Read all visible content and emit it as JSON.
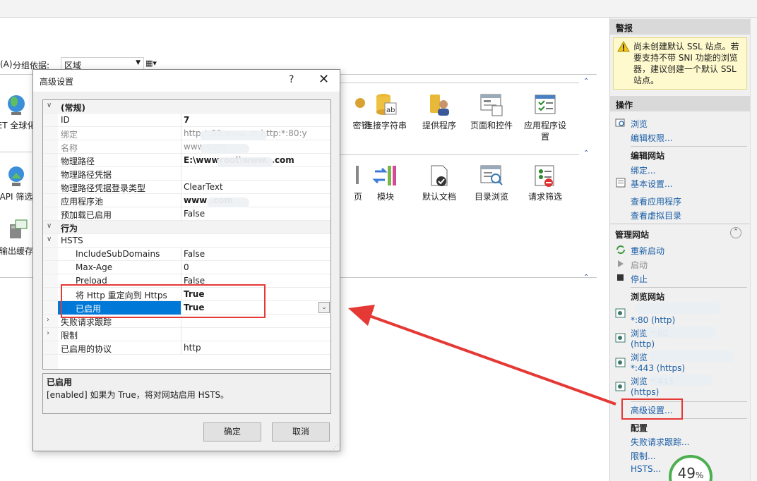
{
  "center": {
    "groupbar": {
      "mode_fragment": "(A)",
      "group_by_label": "分组依据:",
      "group_by_value": "区域"
    },
    "features_row1": [
      {
        "label": "ET 全球化",
        "icon": "globe-icon"
      },
      {
        "label": "密钥",
        "icon": "key-icon"
      },
      {
        "label": "连接字符串",
        "icon": "database-ab-icon"
      },
      {
        "label": "提供程序",
        "icon": "provider-icon"
      },
      {
        "label": "页面和控件",
        "icon": "pages-controls-icon"
      },
      {
        "label": "应用程序设\n置",
        "icon": "app-settings-icon"
      }
    ],
    "features_row2": [
      {
        "label": "API 筛选",
        "icon": "isapi-filter-icon"
      },
      {
        "label": "页",
        "icon": "pages-icon"
      },
      {
        "label": "模块",
        "icon": "modules-icon"
      },
      {
        "label": "默认文档",
        "icon": "default-document-icon"
      },
      {
        "label": "目录浏览",
        "icon": "directory-browsing-icon"
      },
      {
        "label": "请求筛选",
        "icon": "request-filtering-icon"
      }
    ],
    "features_row3": [
      {
        "label": "输出缓存",
        "icon": "output-cache-icon"
      }
    ]
  },
  "dialog": {
    "title": "高级设置",
    "help": "?",
    "close": "✕",
    "rows": [
      {
        "exp": "∨",
        "key": "(常规)",
        "value": "",
        "type": "cat"
      },
      {
        "key": "ID",
        "value": "7",
        "vstyle": "bold"
      },
      {
        "key": "绑定",
        "value": "http:*:80:www.            m,http:*:80:y",
        "kstyle": "gray",
        "vstyle": "gray"
      },
      {
        "key": "名称",
        "value": "www              com",
        "kstyle": "gray",
        "vstyle": "gray"
      },
      {
        "key": "物理路径",
        "value": "E:\\wwwroot\\www.            .com",
        "vstyle": "bold"
      },
      {
        "key": "物理路径凭据",
        "value": ""
      },
      {
        "key": "物理路径凭据登录类型",
        "value": "ClearText"
      },
      {
        "key": "应用程序池",
        "value": "www              .com",
        "vstyle": "bold"
      },
      {
        "key": "预加载已启用",
        "value": "False"
      },
      {
        "exp": "∨",
        "key": "行为",
        "value": "",
        "type": "cat"
      },
      {
        "exp": "∨",
        "key": "HSTS",
        "value": "",
        "type": "sub"
      },
      {
        "key": "IncludeSubDomains",
        "value": "False",
        "type": "child"
      },
      {
        "key": "Max-Age",
        "value": "0",
        "type": "child"
      },
      {
        "key": "Preload",
        "value": "False",
        "type": "child"
      },
      {
        "key": "将 Http 重定向到 Https",
        "value": "True",
        "type": "child",
        "vstyle": "bold"
      },
      {
        "key": "已启用",
        "value": "True",
        "type": "child",
        "vstyle": "bold",
        "selected": true
      },
      {
        "exp": "›",
        "key": "失败请求跟踪",
        "value": ""
      },
      {
        "exp": "›",
        "key": "限制",
        "value": ""
      },
      {
        "key": "已启用的协议",
        "value": "http"
      }
    ],
    "desc_title": "已启用",
    "desc_text": "[enabled] 如果为 True，将对网站启用 HSTS。",
    "ok_label": "确定",
    "cancel_label": "取消"
  },
  "actions": {
    "alerts_header": "警报",
    "alert_text": "尚未创建默认 SSL 站点。若要支持不带 SNI 功能的浏览器，建议创建一个默认 SSL 站点。",
    "ops_header": "操作",
    "browse": "浏览",
    "edit_permissions": "编辑权限...",
    "edit_site_label": "编辑网站",
    "bindings": "绑定...",
    "basic_settings": "基本设置...",
    "view_apps": "查看应用程序",
    "view_vdirs": "查看虚拟目录",
    "manage_site": "管理网站",
    "restart": "重新启动",
    "start": "启动",
    "stop": "停止",
    "browse_site": "浏览网站",
    "browse_links": [
      {
        "line1": "",
        "line2": "*:80 (http)"
      },
      {
        "line1": "浏览                         *:80",
        "line2": "(http)"
      },
      {
        "line1": "浏览",
        "line2": "*:443 (https)"
      },
      {
        "line1": "浏览                        *:443",
        "line2": "(https)"
      }
    ],
    "advanced_settings": "高级设置...",
    "config_label": "配置",
    "failed_request_tracing": "失败请求跟踪...",
    "limits": "限制...",
    "hsts": "HSTS..."
  },
  "overlay": {
    "progress_number": "49",
    "progress_unit": "%",
    "progress_percent": 49
  },
  "colors": {
    "link": "#1a5ea6",
    "selection": "#0078d7",
    "annotation_red": "#e53935",
    "progress_ring": "#4caf50"
  }
}
